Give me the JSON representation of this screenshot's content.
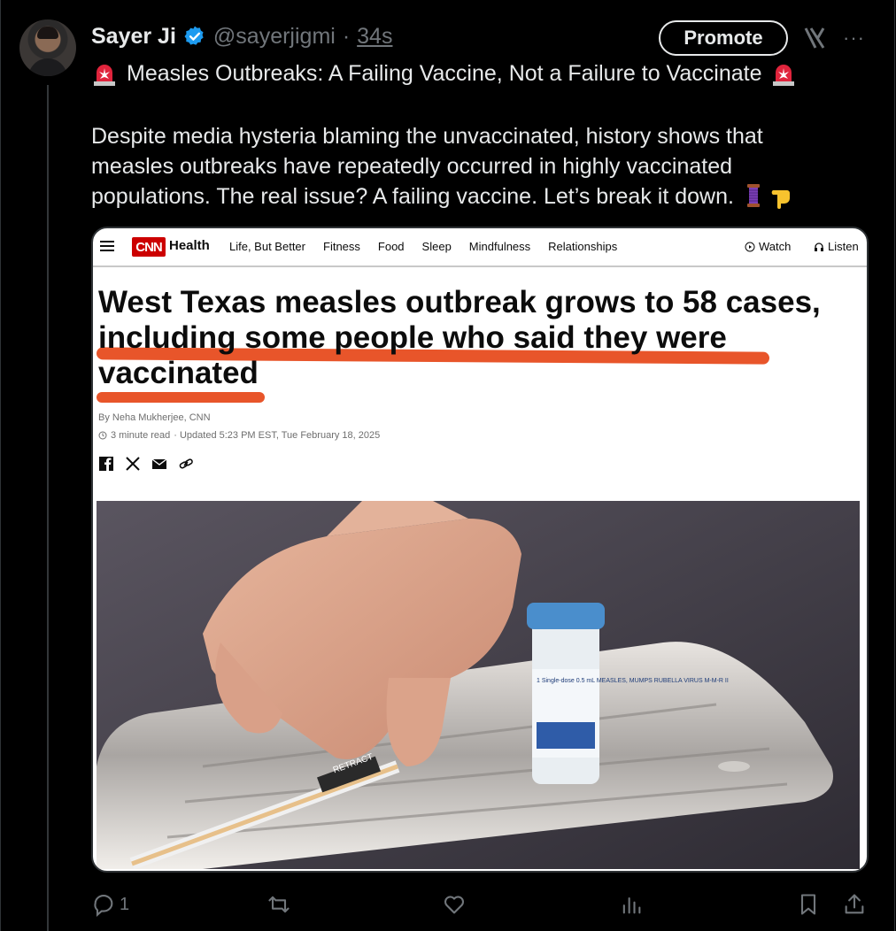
{
  "post": {
    "author_name": "Sayer Ji",
    "handle": "@sayerjigmi",
    "separator": "·",
    "time": "34s",
    "promote_label": "Promote",
    "more_label": "···",
    "title": "Measles Outbreaks: A Failing Vaccine, Not a Failure to Vaccinate",
    "body_lines": [
      "Despite media hysteria blaming the unvaccinated, history shows that",
      "measles outbreaks have repeatedly occurred in highly vaccinated",
      "populations. The real issue? A failing vaccine. Let’s break it down."
    ]
  },
  "article": {
    "logo": "CNN",
    "section": "Health",
    "nav_links": [
      "Life, But Better",
      "Fitness",
      "Food",
      "Sleep",
      "Mindfulness",
      "Relationships"
    ],
    "watch_label": "Watch",
    "listen_label": "Listen",
    "headline_lines": [
      "West Texas measles outbreak grows to 58 cases,",
      "including some people who said they were",
      "vaccinated"
    ],
    "byline": "By Neha Mukherjee, CNN",
    "read_time": "3 minute read",
    "updated": "· Updated 5:23 PM EST, Tue February 18, 2025",
    "vial_label": "1 Single-dose 0.5 mL MEASLES, MUMPS RUBELLA VIRUS M-M-R II",
    "syringe_label": "RETRACT"
  },
  "actions": {
    "reply_count": "1"
  },
  "colors": {
    "background": "#000000",
    "text": "#e7e9ea",
    "muted": "#71767b",
    "verified": "#1d9bf0",
    "highlight": "#e8552a",
    "cnn_red": "#cc0000"
  },
  "icons": [
    "avatar",
    "verified-icon",
    "grok-icon",
    "more-icon",
    "siren-icon",
    "thread-icon",
    "point-down-icon",
    "reply-icon",
    "repost-icon",
    "like-icon",
    "views-icon",
    "bookmark-icon",
    "share-icon"
  ]
}
